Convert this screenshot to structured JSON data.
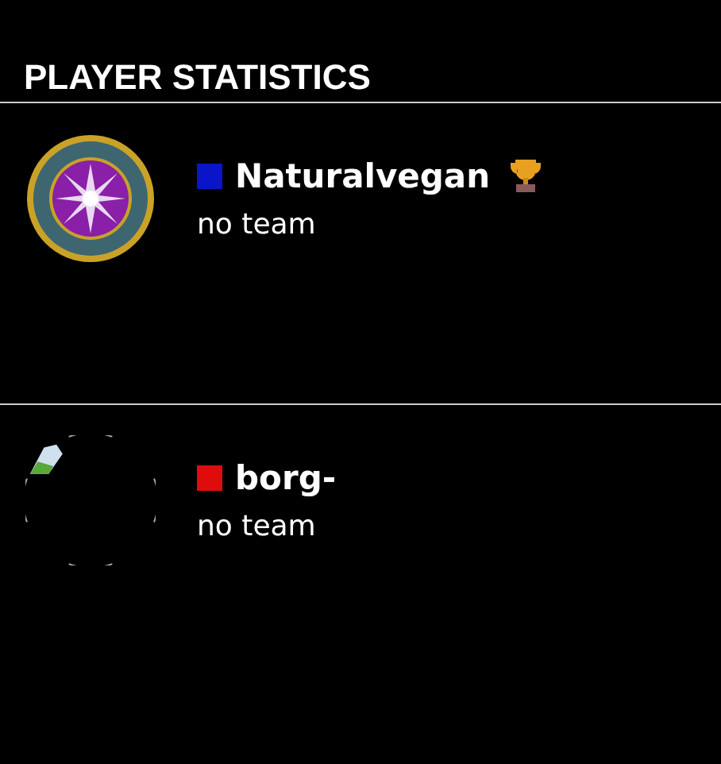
{
  "title": "PLAYER STATISTICS",
  "players": [
    {
      "name": "Naturalvegan",
      "team": "no team",
      "color": "#0a14c8",
      "winner": true,
      "avatar": {
        "kind": "medal"
      }
    },
    {
      "name": "borg-",
      "team": "no team",
      "color": "#e00c0c",
      "winner": false,
      "avatar": {
        "kind": "broken"
      }
    }
  ]
}
